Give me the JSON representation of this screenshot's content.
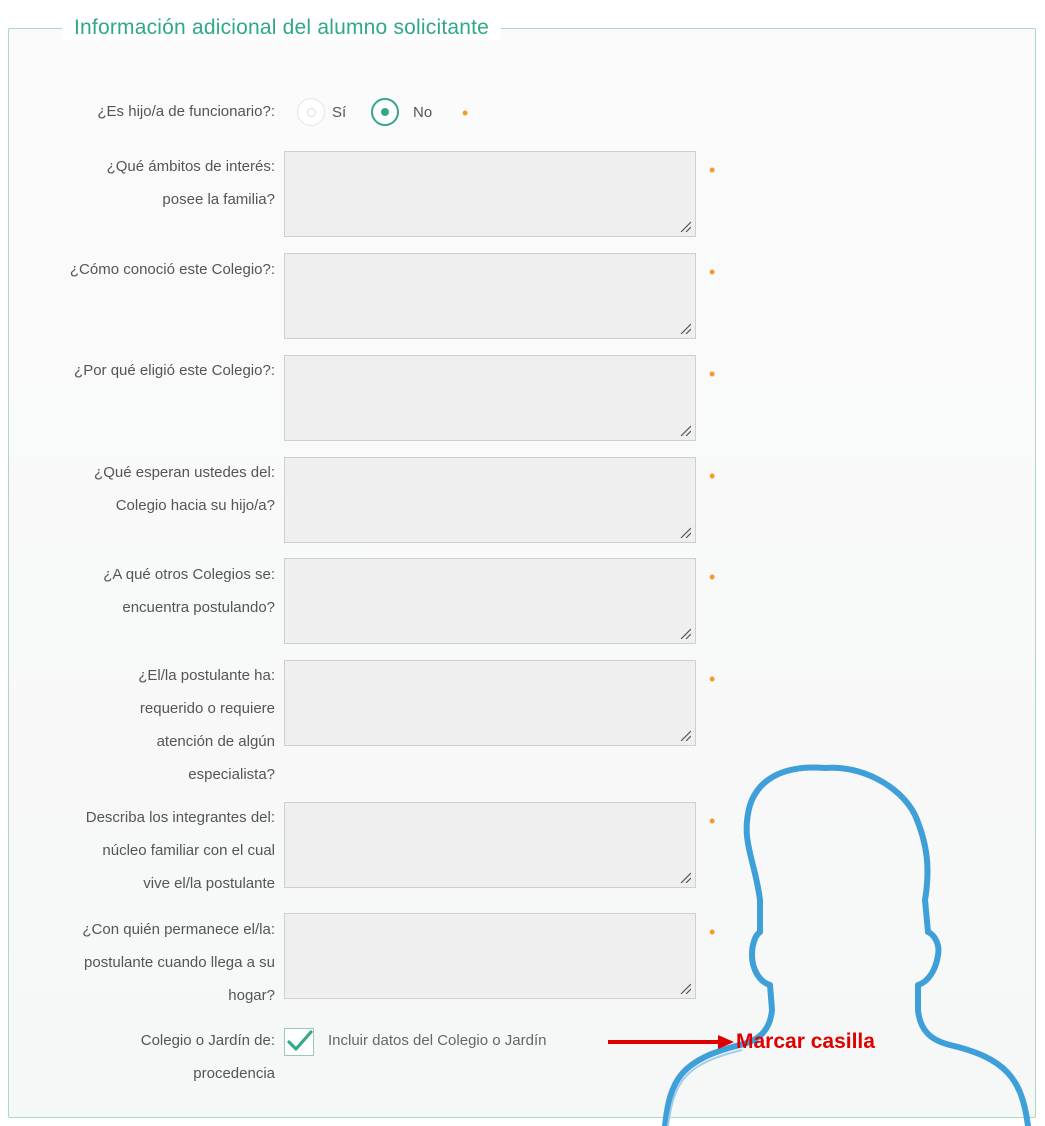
{
  "section": {
    "title": "Información adicional del alumno solicitante"
  },
  "funcionario": {
    "label": "¿Es hijo/a de funcionario?:",
    "option_yes": "Sí",
    "option_no": "No",
    "selected": "No"
  },
  "fields": [
    {
      "label_lines": [
        "¿Qué ámbitos de interés:",
        "posee la familia?"
      ]
    },
    {
      "label_lines": [
        "¿Cómo conoció este Colegio?:"
      ]
    },
    {
      "label_lines": [
        "¿Por qué eligió este Colegio?:"
      ]
    },
    {
      "label_lines": [
        "¿Qué esperan ustedes del:",
        "Colegio hacia su hijo/a?"
      ]
    },
    {
      "label_lines": [
        "¿A qué otros Colegios se:",
        "encuentra postulando?"
      ]
    },
    {
      "label_lines": [
        "¿El/la postulante ha:",
        "requerido o requiere",
        "atención de algún",
        "especialista?"
      ]
    },
    {
      "label_lines": [
        "Describa los integrantes del:",
        "núcleo familiar con el cual",
        "vive el/la postulante"
      ]
    },
    {
      "label_lines": [
        "¿Con quién permanece el/la:",
        "postulante cuando llega a su",
        "hogar?"
      ]
    }
  ],
  "required_marker": "•",
  "procedencia": {
    "label_lines": [
      "Colegio o Jardín de:",
      "procedencia"
    ],
    "checkbox_label": "Incluir datos del Colegio o Jardín",
    "checked": true
  },
  "annotation": {
    "text": "Marcar casilla",
    "color": "#e00000"
  },
  "colors": {
    "accent": "#2fa88a",
    "required": "#f39a2b",
    "silhouette": "#3f9fd8"
  }
}
